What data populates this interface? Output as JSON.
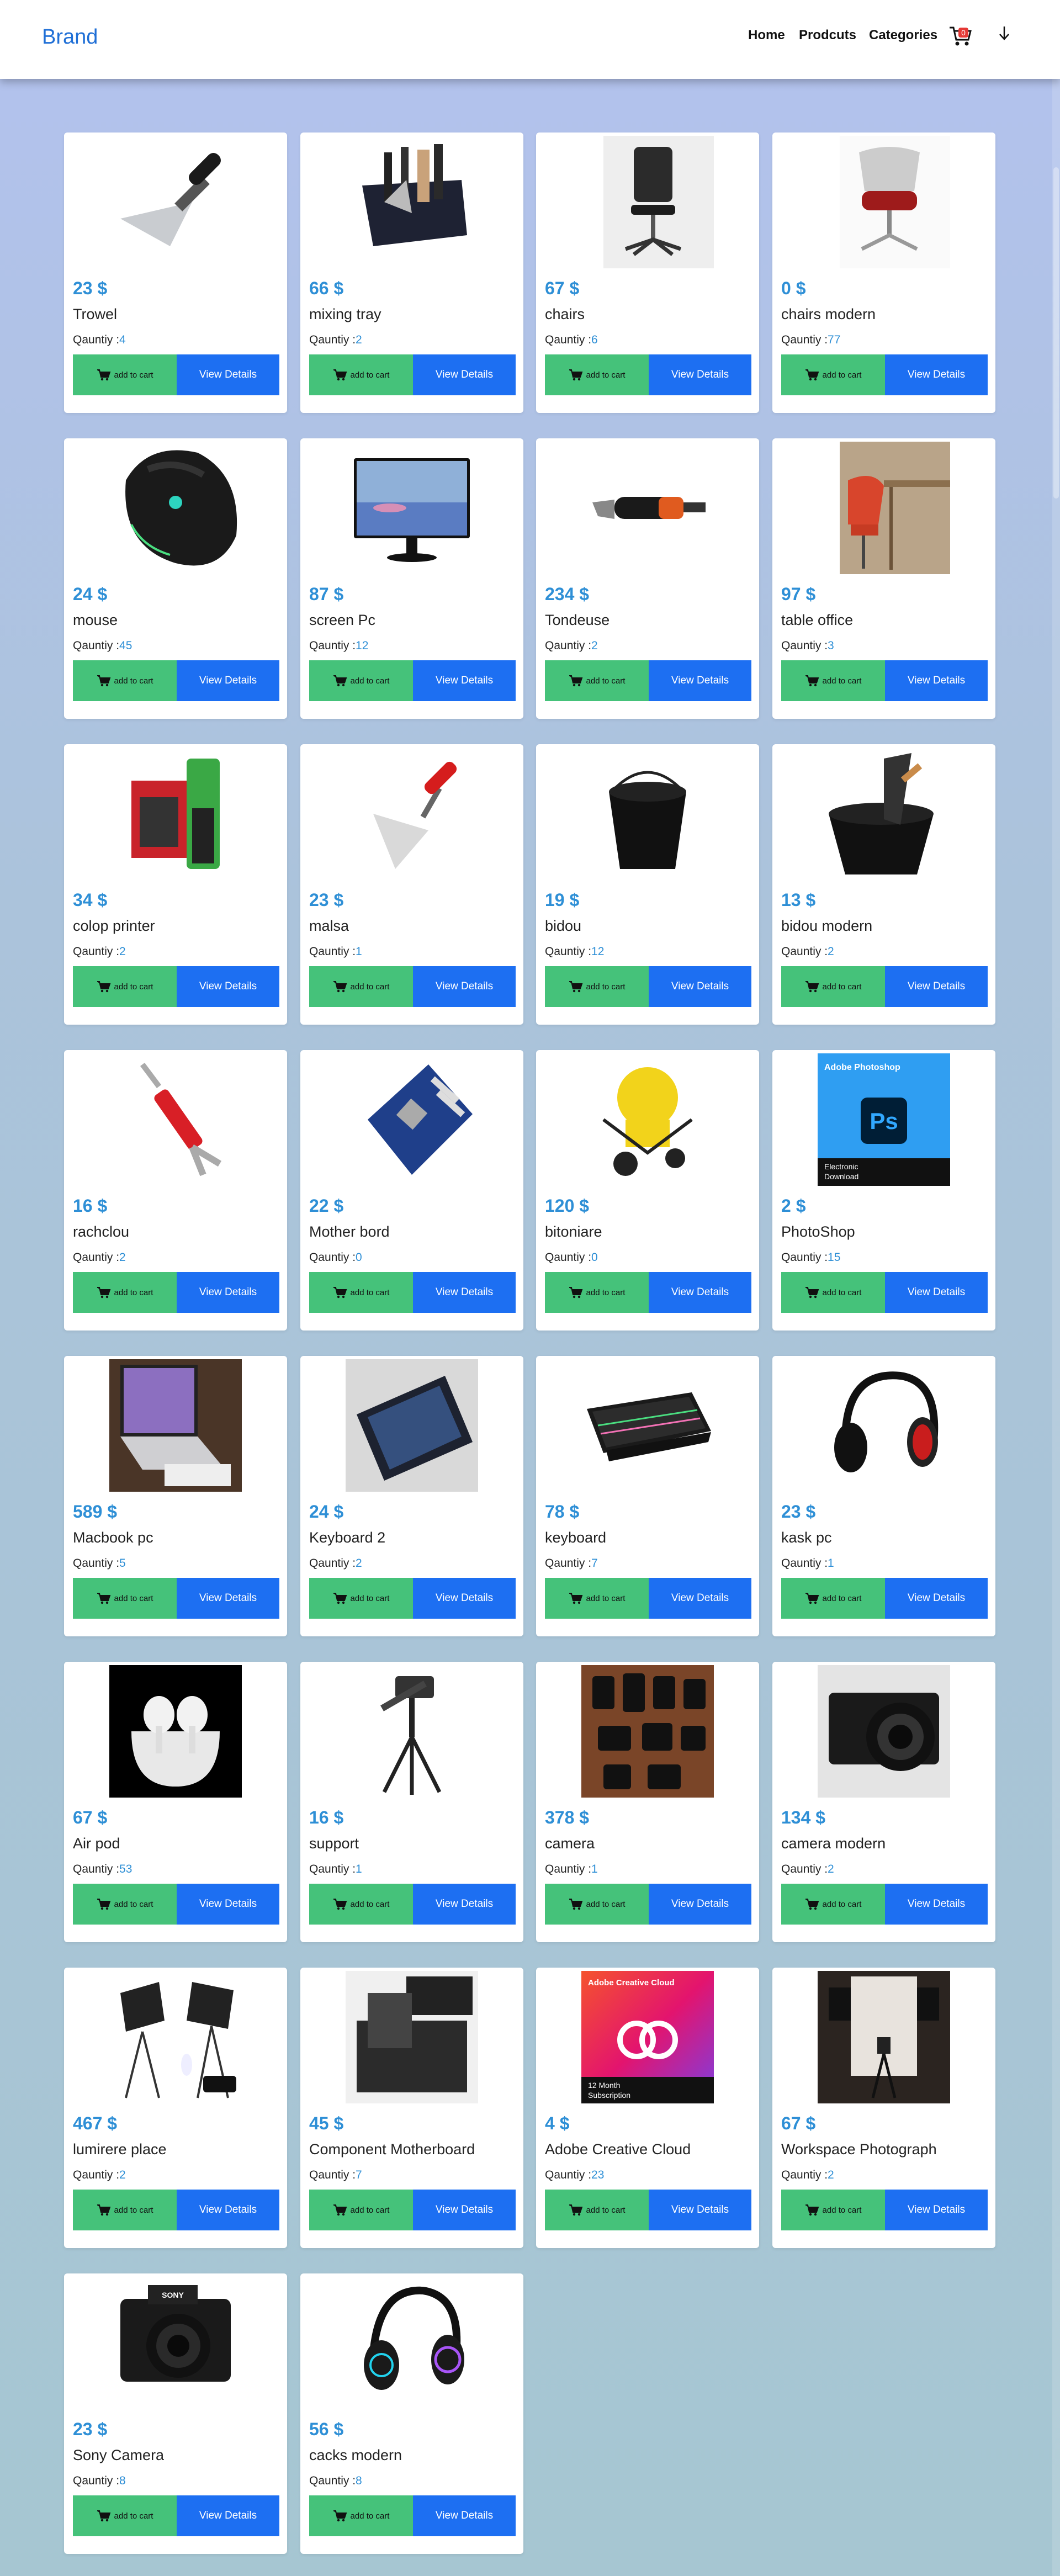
{
  "nav": {
    "brand": "Brand",
    "links": [
      "Home",
      "Prodcuts",
      "Categories"
    ],
    "cart_count": "0"
  },
  "labels": {
    "add_to_cart": "add to cart",
    "view_details": "View Details",
    "quantity_prefix": "Qauntiy :"
  },
  "products": [
    {
      "price": "23 $",
      "name": "Trowel",
      "qty": "4",
      "icon": "trowel"
    },
    {
      "price": "66 $",
      "name": "mixing tray",
      "qty": "2",
      "icon": "mixing-tray"
    },
    {
      "price": "67 $",
      "name": "chairs",
      "qty": "6",
      "icon": "office-chair"
    },
    {
      "price": "0 $",
      "name": "chairs modern",
      "qty": "77",
      "icon": "red-chair"
    },
    {
      "price": "24 $",
      "name": "mouse",
      "qty": "45",
      "icon": "gaming-mouse"
    },
    {
      "price": "87 $",
      "name": "screen Pc",
      "qty": "12",
      "icon": "monitor"
    },
    {
      "price": "234 $",
      "name": "Tondeuse",
      "qty": "2",
      "icon": "power-tool"
    },
    {
      "price": "97 $",
      "name": "table office",
      "qty": "3",
      "icon": "office-desk"
    },
    {
      "price": "34 $",
      "name": "colop printer",
      "qty": "2",
      "icon": "stamp-printer"
    },
    {
      "price": "23 $",
      "name": "malsa",
      "qty": "1",
      "icon": "trowel-red"
    },
    {
      "price": "19 $",
      "name": "bidou",
      "qty": "12",
      "icon": "bucket"
    },
    {
      "price": "13 $",
      "name": "bidou modern",
      "qty": "2",
      "icon": "bucket-tools"
    },
    {
      "price": "16 $",
      "name": "rachclou",
      "qty": "2",
      "icon": "nail-puller"
    },
    {
      "price": "22 $",
      "name": "Mother bord",
      "qty": "0",
      "icon": "motherboard"
    },
    {
      "price": "120 $",
      "name": "bitoniare",
      "qty": "0",
      "icon": "cement-mixer"
    },
    {
      "price": "2 $",
      "name": "PhotoShop",
      "qty": "15",
      "icon": "photoshop-box",
      "art": {
        "title": "Adobe Photoshop",
        "mark": "Ps",
        "sub1": "Electronic",
        "sub2": "Download"
      }
    },
    {
      "price": "589 $",
      "name": "Macbook pc",
      "qty": "5",
      "icon": "laptop"
    },
    {
      "price": "24 $",
      "name": "Keyboard 2",
      "qty": "2",
      "icon": "keyboard-compact"
    },
    {
      "price": "78 $",
      "name": "keyboard",
      "qty": "7",
      "icon": "keyboard-rgb"
    },
    {
      "price": "23 $",
      "name": "kask pc",
      "qty": "1",
      "icon": "headset-red"
    },
    {
      "price": "67 $",
      "name": "Air pod",
      "qty": "53",
      "icon": "earbuds"
    },
    {
      "price": "16 $",
      "name": "support",
      "qty": "1",
      "icon": "tripod"
    },
    {
      "price": "378 $",
      "name": "camera",
      "qty": "1",
      "icon": "camera-lenses"
    },
    {
      "price": "134 $",
      "name": "camera modern",
      "qty": "2",
      "icon": "camera"
    },
    {
      "price": "467 $",
      "name": "lumirere place",
      "qty": "2",
      "icon": "softbox-lights"
    },
    {
      "price": "45 $",
      "name": "Component Motherboard",
      "qty": "7",
      "icon": "motherboard-kit"
    },
    {
      "price": "4 $",
      "name": "Adobe Creative Cloud",
      "qty": "23",
      "icon": "creative-cloud-box",
      "art": {
        "title": "Adobe Creative Cloud",
        "mark": "",
        "sub1": "12 Month",
        "sub2": "Subscription"
      }
    },
    {
      "price": "67 $",
      "name": "Workspace Photograph",
      "qty": "2",
      "icon": "photo-studio"
    },
    {
      "price": "23 $",
      "name": "Sony Camera",
      "qty": "8",
      "icon": "sony-camera",
      "art": {
        "title": "SONY"
      }
    },
    {
      "price": "56 $",
      "name": "cacks modern",
      "qty": "8",
      "icon": "headset-rgb"
    }
  ],
  "colors": {
    "brand": "#1f6fd6",
    "price": "#2e8fd6",
    "add_to_cart_bg": "#45c27a",
    "view_details_bg": "#1d6ff2",
    "cart_badge": "#e53935"
  }
}
